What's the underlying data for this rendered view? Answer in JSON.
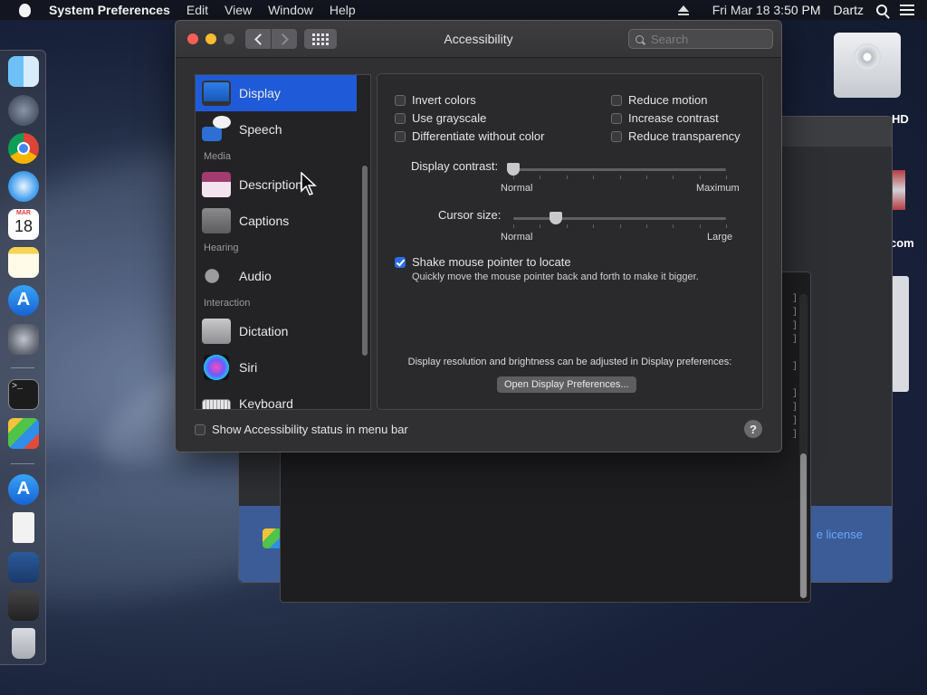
{
  "menubar": {
    "app_name": "System Preferences",
    "items": [
      "Edit",
      "View",
      "Window",
      "Help"
    ],
    "datetime": "Fri Mar 18  3:50 PM",
    "user": "Dartz"
  },
  "dock": {
    "calendar_month": "MAR",
    "calendar_day": "18"
  },
  "desktop": {
    "drive_label_fragment": "HD",
    "url_fragment": "com",
    "license_fragment": "e license"
  },
  "window": {
    "title": "Accessibility",
    "search_placeholder": "Search"
  },
  "sidebar": {
    "items": [
      {
        "label": "Display",
        "icon": "display-icon",
        "selected": true
      },
      {
        "label": "Speech",
        "icon": "speech-icon"
      },
      {
        "label": "Description",
        "icon": "description-icon"
      },
      {
        "label": "Captions",
        "icon": "captions-icon"
      },
      {
        "label": "Audio",
        "icon": "speaker-icon"
      },
      {
        "label": "Dictation",
        "icon": "microphone-icon"
      },
      {
        "label": "Siri",
        "icon": "siri-icon"
      },
      {
        "label": "Keyboard",
        "icon": "keyboard-icon"
      }
    ],
    "sections": [
      "Media",
      "Hearing",
      "Interaction"
    ]
  },
  "display": {
    "checkboxes": {
      "invert_colors": {
        "label": "Invert colors",
        "checked": false
      },
      "use_grayscale": {
        "label": "Use grayscale",
        "checked": false
      },
      "differentiate": {
        "label": "Differentiate without color",
        "checked": false
      },
      "reduce_motion": {
        "label": "Reduce motion",
        "checked": false
      },
      "increase_contrast": {
        "label": "Increase contrast",
        "checked": false
      },
      "reduce_transparency": {
        "label": "Reduce transparency",
        "checked": false
      }
    },
    "display_contrast": {
      "label": "Display contrast:",
      "min_label": "Normal",
      "max_label": "Maximum",
      "value": 0.0
    },
    "cursor_size": {
      "label": "Cursor size:",
      "min_label": "Normal",
      "max_label": "Large",
      "value": 0.2
    },
    "shake": {
      "label": "Shake mouse pointer to locate",
      "checked": true,
      "description": "Quickly move the mouse pointer back and forth to make it bigger."
    },
    "note": "Display resolution and brightness can be adjusted in Display preferences:",
    "open_button": "Open Display Preferences..."
  },
  "footer": {
    "status_checkbox": "Show Accessibility status in menu bar",
    "help": "?"
  }
}
